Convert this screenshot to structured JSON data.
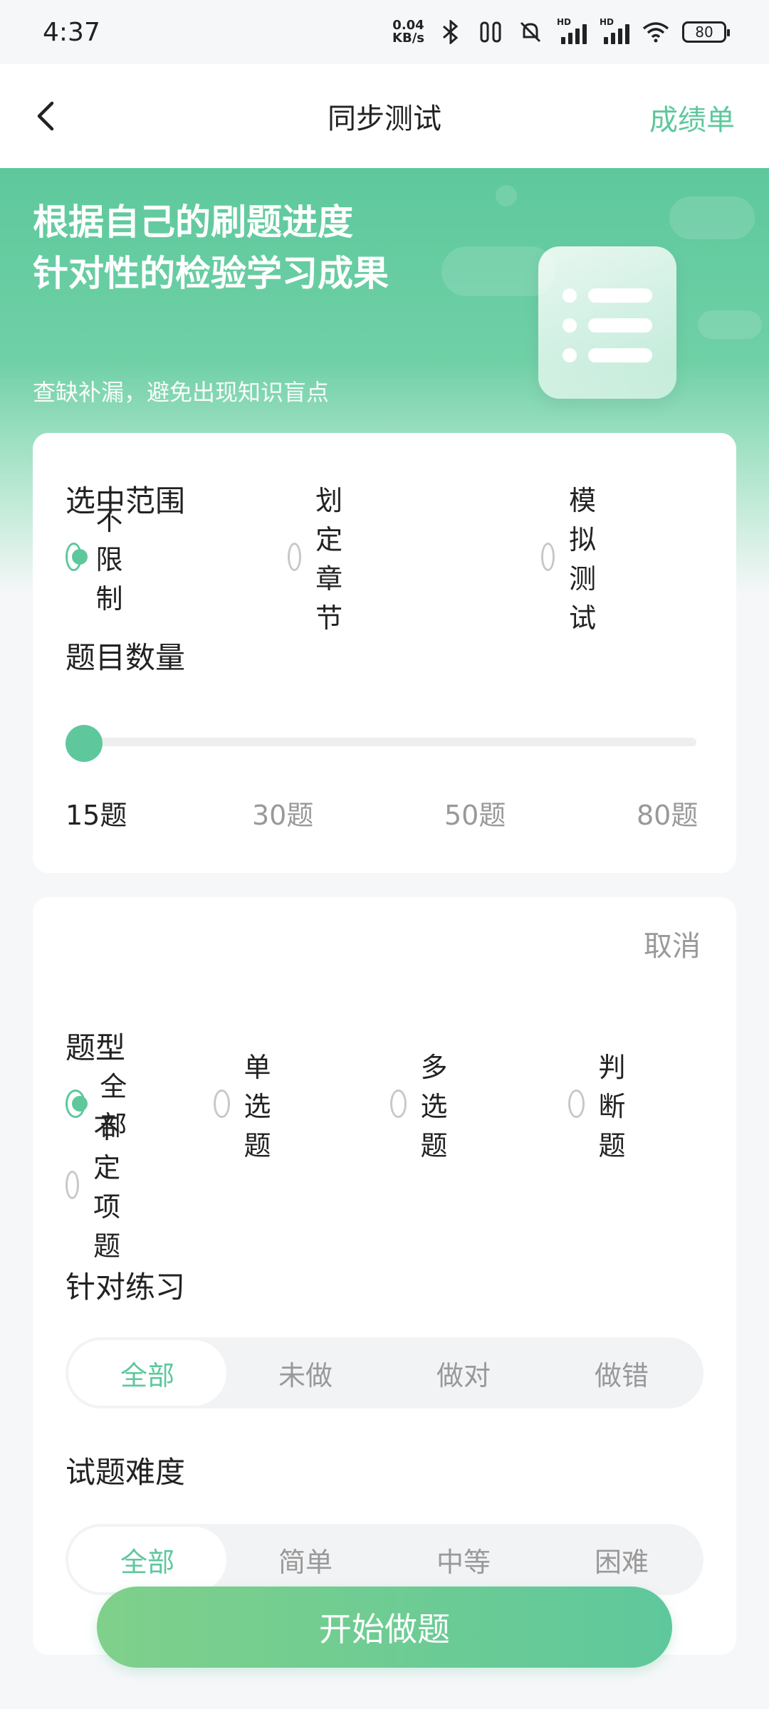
{
  "status_bar": {
    "time": "4:37",
    "net_speed_value": "0.04",
    "net_speed_unit": "KB/s",
    "battery": "80"
  },
  "header": {
    "title": "同步测试",
    "report_link": "成绩单"
  },
  "banner": {
    "line1": "根据自己的刷题进度",
    "line2": "针对性的检验学习成果",
    "sub": "查缺补漏，避免出现知识盲点"
  },
  "scope": {
    "title": "选中范围",
    "options": [
      {
        "label": "不限制",
        "checked": true
      },
      {
        "label": "划定章节",
        "checked": false
      },
      {
        "label": "模拟测试",
        "checked": false
      }
    ]
  },
  "count": {
    "title": "题目数量",
    "ticks": [
      "15题",
      "30题",
      "50题",
      "80题"
    ],
    "selected": "15题"
  },
  "filters": {
    "cancel": "取消",
    "type_title": "题型",
    "types": [
      {
        "label": "全部",
        "checked": true
      },
      {
        "label": "单选题",
        "checked": false
      },
      {
        "label": "多选题",
        "checked": false
      },
      {
        "label": "判断题",
        "checked": false
      },
      {
        "label": "不定项题",
        "checked": false
      }
    ],
    "practice_title": "针对练习",
    "practice_options": [
      "全部",
      "未做",
      "做对",
      "做错"
    ],
    "practice_selected": "全部",
    "difficulty_title": "试题难度",
    "difficulty_options": [
      "全部",
      "简单",
      "中等",
      "困难"
    ],
    "difficulty_selected": "全部"
  },
  "start_button": "开始做题",
  "colors": {
    "accent": "#5ec89c",
    "muted": "#999999"
  }
}
